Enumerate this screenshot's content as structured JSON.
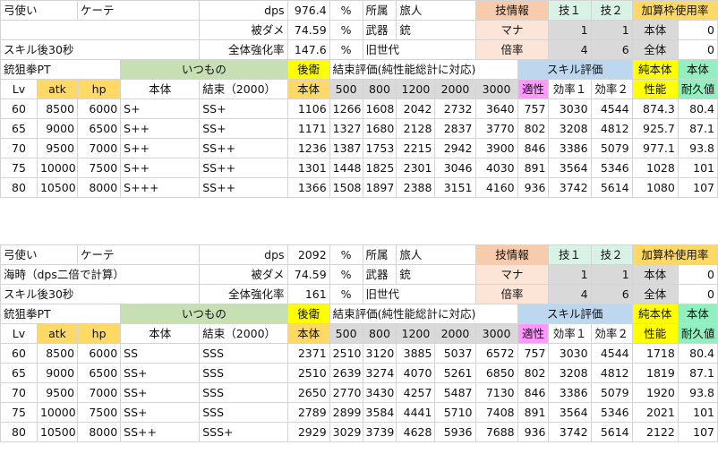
{
  "sections": [
    {
      "info": {
        "class_label": "弓使い",
        "char_name": "ケーテ",
        "note": "",
        "skill_note": "スキル後30秒",
        "dps_label": "dps",
        "dps_value": "976.4",
        "dps_unit": "%",
        "dmg_label": "被ダメ",
        "dmg_value": "74.59",
        "dmg_unit": "%",
        "buff_label": "全体強化率",
        "buff_value": "147.6",
        "buff_unit": "%",
        "aff_label": "所属",
        "aff_value": "旅人",
        "weapon_label": "武器",
        "weapon_value": "銃",
        "gen_label": "旧世代",
        "skillinfo_label": "技情報",
        "mana_label": "マナ",
        "rate_label": "倍率",
        "skill1_label": "技１",
        "skill2_label": "技２",
        "mana1": "1",
        "mana2": "1",
        "rate1": "4",
        "rate2": "6",
        "add_label": "加算枠使用率",
        "self_label": "本体",
        "self_value": "0",
        "all_label": "全体",
        "all_value": "0"
      },
      "header": {
        "team": "銃狙拳PT",
        "itsumono": "いつもの",
        "kouei": "後衛",
        "kessoku_eval": "結束評価(純性能総計に対応)",
        "skill_eval": "スキル評価",
        "pure": "純本体",
        "body": "本体",
        "lv": "Lv",
        "atk": "atk",
        "hp": "hp",
        "honntai": "本体",
        "kessoku": "結束（2000）",
        "honntai2": "本体",
        "k500": "500",
        "k800": "800",
        "k1200": "1200",
        "k2000": "2000",
        "k3000": "3000",
        "tekisei": "適性",
        "eff1": "効率１",
        "eff2": "効率２",
        "seinou": "性能",
        "taikyu": "耐久値"
      },
      "rows": [
        [
          "60",
          "8500",
          "6000",
          "S+",
          "SS+",
          "1106",
          "1266",
          "1608",
          "2042",
          "2732",
          "3640",
          "757",
          "3030",
          "4544",
          "874.3",
          "80.4"
        ],
        [
          "65",
          "9000",
          "6500",
          "S++",
          "SS+",
          "1171",
          "1327",
          "1680",
          "2128",
          "2837",
          "3770",
          "802",
          "3208",
          "4812",
          "925.7",
          "87.1"
        ],
        [
          "70",
          "9500",
          "7000",
          "S++",
          "SS++",
          "1236",
          "1387",
          "1753",
          "2215",
          "2942",
          "3900",
          "846",
          "3386",
          "5079",
          "977.1",
          "93.8"
        ],
        [
          "75",
          "10000",
          "7500",
          "S++",
          "SS++",
          "1301",
          "1448",
          "1825",
          "2301",
          "3046",
          "4030",
          "891",
          "3564",
          "5346",
          "1028",
          "101"
        ],
        [
          "80",
          "10500",
          "8000",
          "S+++",
          "SS++",
          "1366",
          "1508",
          "1897",
          "2388",
          "3151",
          "4160",
          "936",
          "3742",
          "5614",
          "1080",
          "107"
        ]
      ]
    },
    {
      "info": {
        "class_label": "弓使い",
        "char_name": "ケーテ",
        "note": "海時（dps二倍で計算）",
        "skill_note": "スキル後30秒",
        "dps_label": "dps",
        "dps_value": "2092",
        "dps_unit": "%",
        "dmg_label": "被ダメ",
        "dmg_value": "74.59",
        "dmg_unit": "%",
        "buff_label": "全体強化率",
        "buff_value": "161",
        "buff_unit": "%",
        "aff_label": "所属",
        "aff_value": "旅人",
        "weapon_label": "武器",
        "weapon_value": "銃",
        "gen_label": "旧世代",
        "skillinfo_label": "技情報",
        "mana_label": "マナ",
        "rate_label": "倍率",
        "skill1_label": "技１",
        "skill2_label": "技２",
        "mana1": "1",
        "mana2": "1",
        "rate1": "4",
        "rate2": "6",
        "add_label": "加算枠使用率",
        "self_label": "本体",
        "self_value": "0",
        "all_label": "全体",
        "all_value": "0"
      },
      "header": {
        "team": "銃狙拳PT",
        "itsumono": "いつもの",
        "kouei": "後衛",
        "kessoku_eval": "結束評価(純性能総計に対応)",
        "skill_eval": "スキル評価",
        "pure": "純本体",
        "body": "本体",
        "lv": "Lv",
        "atk": "atk",
        "hp": "hp",
        "honntai": "本体",
        "kessoku": "結束（2000）",
        "honntai2": "本体",
        "k500": "500",
        "k800": "800",
        "k1200": "1200",
        "k2000": "2000",
        "k3000": "3000",
        "tekisei": "適性",
        "eff1": "効率１",
        "eff2": "効率２",
        "seinou": "性能",
        "taikyu": "耐久値"
      },
      "rows": [
        [
          "60",
          "8500",
          "6000",
          "SS",
          "SSS",
          "2371",
          "2510",
          "3120",
          "3885",
          "5037",
          "6572",
          "757",
          "3030",
          "4544",
          "1718",
          "80.4"
        ],
        [
          "65",
          "9000",
          "6500",
          "SS+",
          "SSS",
          "2510",
          "2639",
          "3274",
          "4070",
          "5261",
          "6850",
          "802",
          "3208",
          "4812",
          "1819",
          "87.1"
        ],
        [
          "70",
          "9500",
          "7000",
          "SS+",
          "SSS",
          "2650",
          "2770",
          "3430",
          "4257",
          "5487",
          "7130",
          "846",
          "3386",
          "5079",
          "1920",
          "93.8"
        ],
        [
          "75",
          "10000",
          "7500",
          "SS+",
          "SSS",
          "2789",
          "2899",
          "3584",
          "4441",
          "5710",
          "7408",
          "891",
          "3564",
          "5346",
          "2021",
          "101"
        ],
        [
          "80",
          "10500",
          "8000",
          "SS++",
          "SSS+",
          "2929",
          "3029",
          "3739",
          "4628",
          "5936",
          "7688",
          "936",
          "3742",
          "5614",
          "2122",
          "107"
        ]
      ]
    }
  ]
}
